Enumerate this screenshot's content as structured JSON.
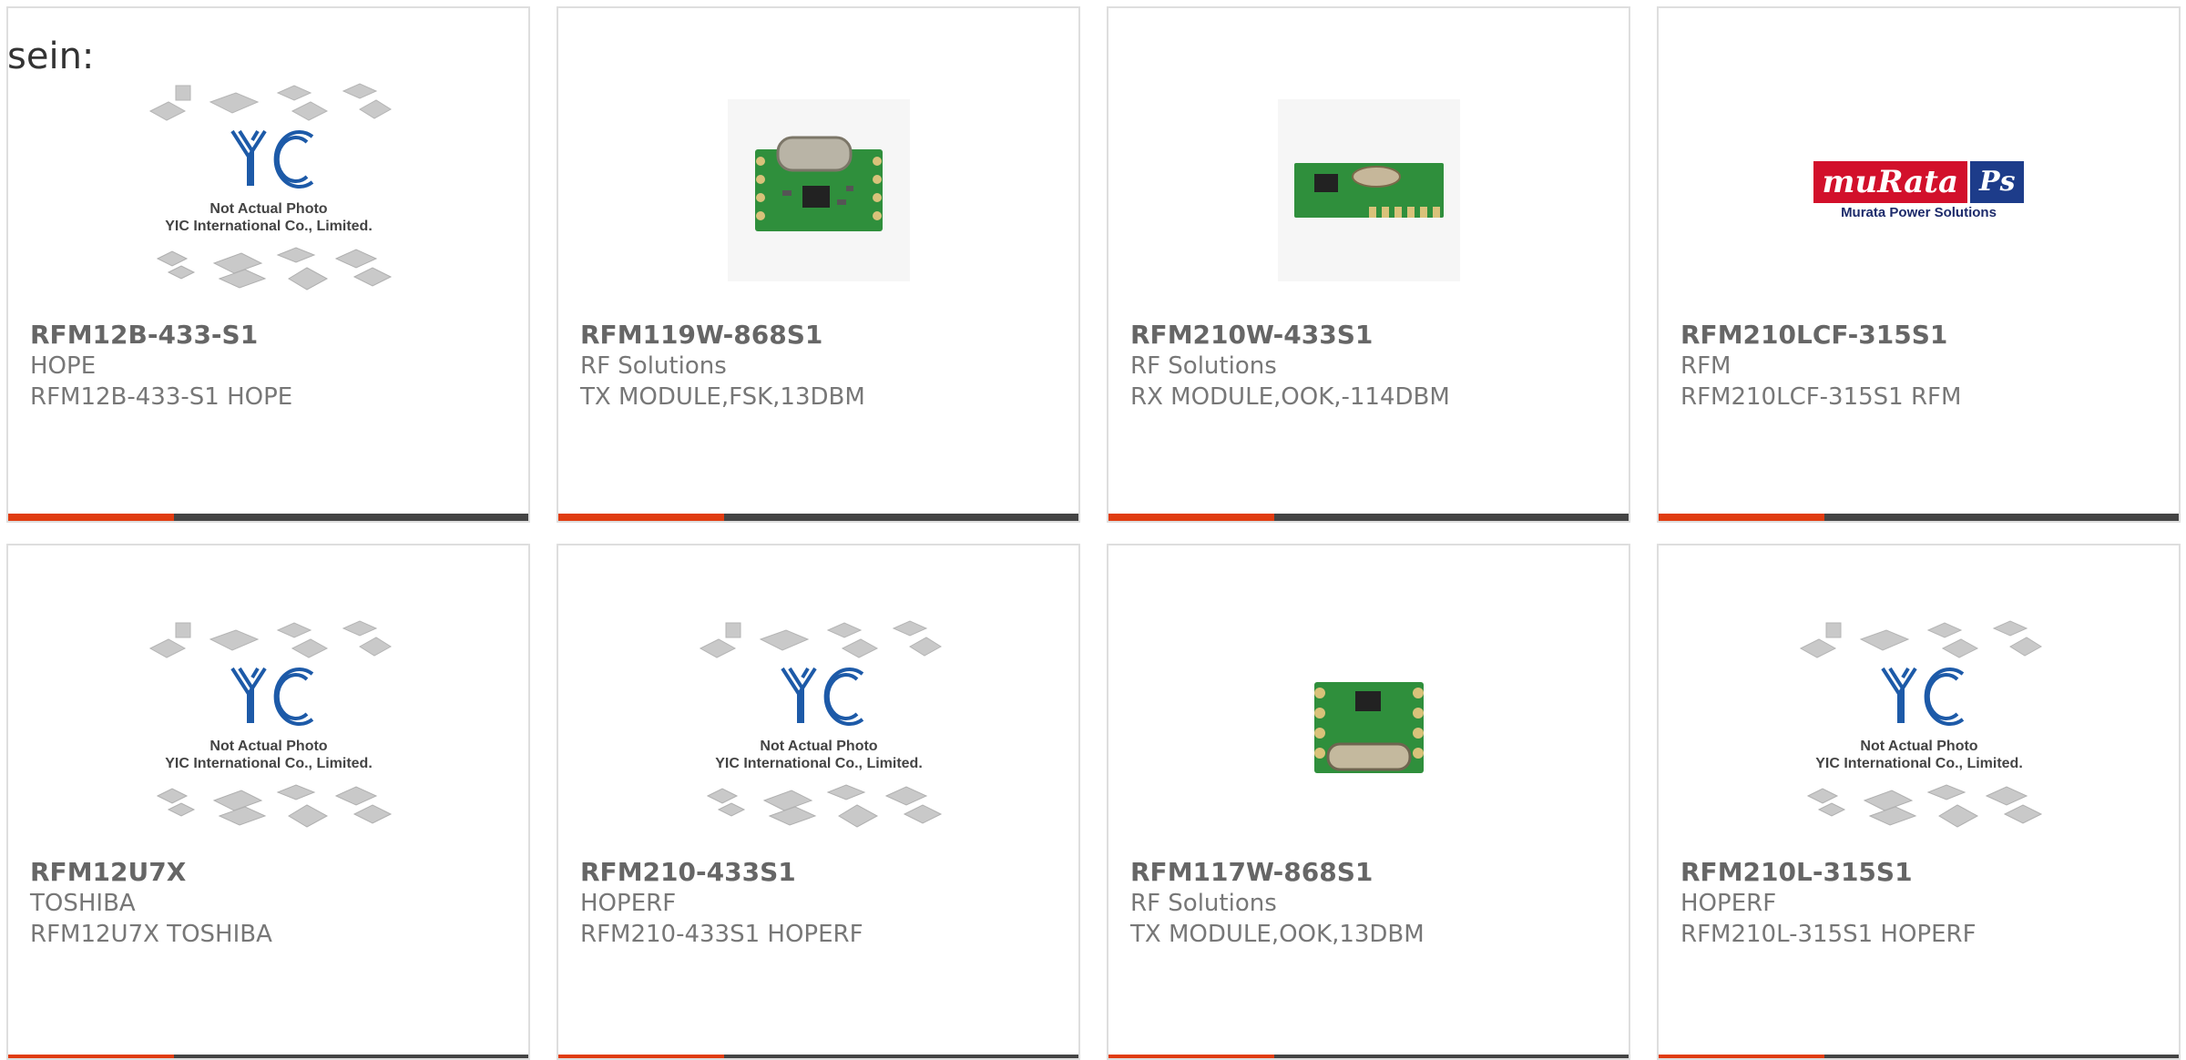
{
  "page": {
    "text": "sein:"
  },
  "colors": {
    "accent": "#e03c10",
    "bar": "#444444",
    "yic_blue": "#1d5aa8",
    "pcb_green": "#2f8f3c"
  },
  "products": [
    {
      "part_number": "RFM12B-433-S1",
      "manufacturer": "HOPE",
      "description": "RFM12B-433-S1 HOPE",
      "image": "yic-placeholder",
      "placeholder_line1": "Not Actual Photo",
      "placeholder_line2": "YIC International Co., Limited."
    },
    {
      "part_number": "RFM119W-868S1",
      "manufacturer": "RF Solutions",
      "description": "TX MODULE,FSK,13DBM",
      "image": "pcb-module-crystal-top"
    },
    {
      "part_number": "RFM210W-433S1",
      "manufacturer": "RF Solutions",
      "description": "RX MODULE,OOK,-114DBM",
      "image": "pcb-module-long"
    },
    {
      "part_number": "RFM210LCF-315S1",
      "manufacturer": "RFM",
      "description": "RFM210LCF-315S1 RFM",
      "image": "murata-logo",
      "logo_text": "muRata",
      "logo_badge": "Ps",
      "logo_sub": "Murata Power Solutions"
    },
    {
      "part_number": "RFM12U7X",
      "manufacturer": "TOSHIBA",
      "description": "RFM12U7X TOSHIBA",
      "image": "yic-placeholder",
      "placeholder_line1": "Not Actual Photo",
      "placeholder_line2": "YIC International Co., Limited."
    },
    {
      "part_number": "RFM210-433S1",
      "manufacturer": "HOPERF",
      "description": "RFM210-433S1 HOPERF",
      "image": "yic-placeholder",
      "placeholder_line1": "Not Actual Photo",
      "placeholder_line2": "YIC International Co., Limited."
    },
    {
      "part_number": "RFM117W-868S1",
      "manufacturer": "RF Solutions",
      "description": "TX MODULE,OOK,13DBM",
      "image": "pcb-module-crystal-bottom"
    },
    {
      "part_number": "RFM210L-315S1",
      "manufacturer": "HOPERF",
      "description": "RFM210L-315S1 HOPERF",
      "image": "yic-placeholder",
      "placeholder_line1": "Not Actual Photo",
      "placeholder_line2": "YIC International Co., Limited."
    }
  ]
}
